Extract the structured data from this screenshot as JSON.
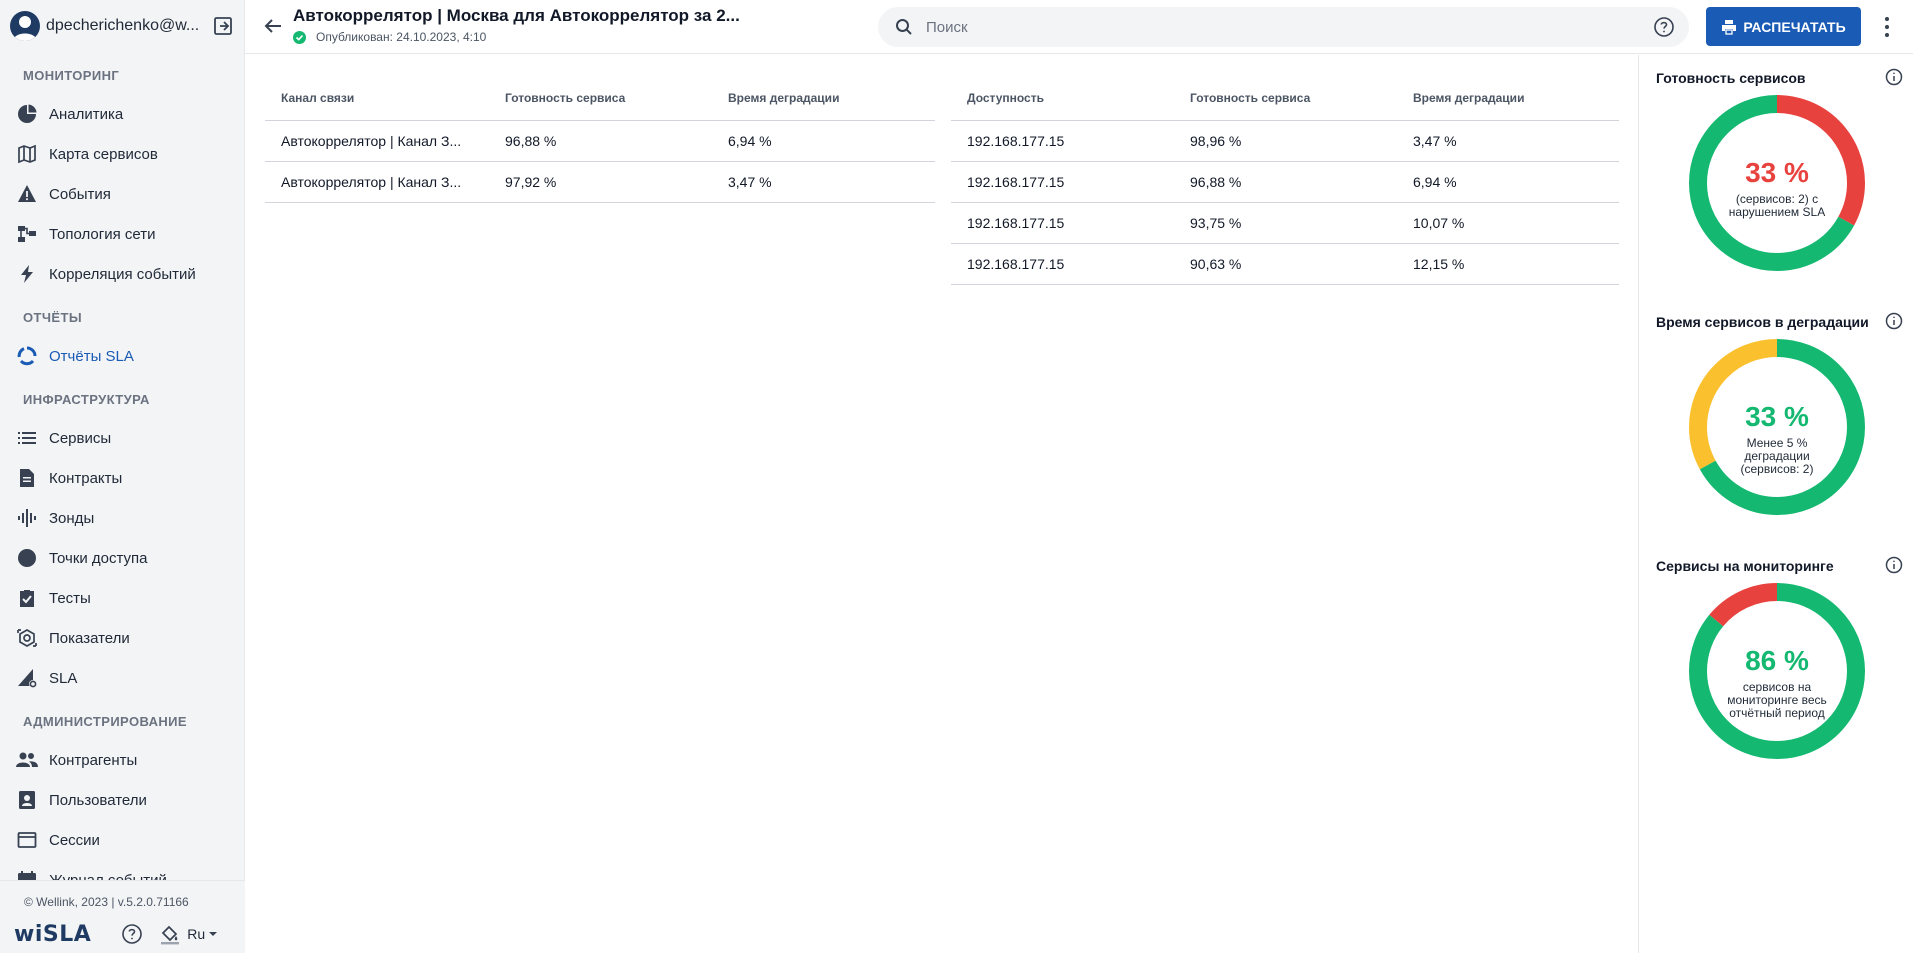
{
  "user": {
    "name": "dpecherichenko@w..."
  },
  "sidebar": {
    "sections": [
      {
        "title": "МОНИТОРИНГ",
        "items": [
          {
            "label": "Аналитика",
            "icon": "pie-chart-icon"
          },
          {
            "label": "Карта сервисов",
            "icon": "map-icon"
          },
          {
            "label": "События",
            "icon": "warning-icon"
          },
          {
            "label": "Топология сети",
            "icon": "topology-icon"
          },
          {
            "label": "Корреляция событий",
            "icon": "bolt-icon"
          }
        ]
      },
      {
        "title": "ОТЧЁТЫ",
        "items": [
          {
            "label": "Отчёты SLA",
            "icon": "circle-report-icon",
            "active": true
          }
        ]
      },
      {
        "title": "ИНФРАСТРУКТУРА",
        "items": [
          {
            "label": "Сервисы",
            "icon": "list-icon"
          },
          {
            "label": "Контракты",
            "icon": "document-icon"
          },
          {
            "label": "Зонды",
            "icon": "probe-icon"
          },
          {
            "label": "Точки доступа",
            "icon": "dot-icon"
          },
          {
            "label": "Тесты",
            "icon": "clipboard-check-icon"
          },
          {
            "label": "Показатели",
            "icon": "metrics-icon"
          },
          {
            "label": "SLA",
            "icon": "sla-icon"
          }
        ]
      },
      {
        "title": "АДМИНИСТРИРОВАНИЕ",
        "items": [
          {
            "label": "Контрагенты",
            "icon": "people-icon"
          },
          {
            "label": "Пользователи",
            "icon": "user-card-icon"
          },
          {
            "label": "Сессии",
            "icon": "window-icon"
          },
          {
            "label": "Журнал событий",
            "icon": "calendar-icon"
          }
        ]
      }
    ],
    "copyright": "© Wellink, 2023 | v.5.2.0.71166",
    "logo": "wiSLA",
    "language": "Ru"
  },
  "header": {
    "title": "Автокоррелятор | Москва для Автокоррелятор за 2...",
    "published": "Опубликован: 24.10.2023, 4:10",
    "search_placeholder": "Поиск",
    "print_label": "РАСПЕЧАТАТЬ"
  },
  "table1": {
    "headers": [
      "Канал связи",
      "Готовность сервиса",
      "Время деградации"
    ],
    "rows": [
      [
        "Автокоррелятор | Канал З...",
        "96,88 %",
        "6,94 %"
      ],
      [
        "Автокоррелятор | Канал З...",
        "97,92 %",
        "3,47 %"
      ]
    ]
  },
  "table2": {
    "headers": [
      "Доступность",
      "Готовность сервиса",
      "Время деградации"
    ],
    "rows": [
      [
        "192.168.177.15",
        "98,96 %",
        "3,47 %"
      ],
      [
        "192.168.177.15",
        "96,88 %",
        "6,94 %"
      ],
      [
        "192.168.177.15",
        "93,75 %",
        "10,07 %"
      ],
      [
        "192.168.177.15",
        "90,63 %",
        "12,15 %"
      ]
    ]
  },
  "widgets": [
    {
      "title": "Готовность сервисов",
      "percent": "33 %",
      "percent_color": "#e8423f",
      "description": "(сервисов: 2) с нарушением SLA",
      "segments": [
        {
          "fraction": 0.33,
          "color": "#e8423f"
        },
        {
          "fraction": 0.67,
          "color": "#14b870"
        }
      ]
    },
    {
      "title": "Время сервисов в деградации",
      "percent": "33 %",
      "percent_color": "#14b870",
      "description": "Менее 5 % деградации (сервисов: 2)",
      "segments": [
        {
          "fraction": 0.67,
          "color": "#14b870"
        },
        {
          "fraction": 0.33,
          "color": "#fbc02d"
        }
      ]
    },
    {
      "title": "Сервисы на мониторинге",
      "percent": "86 %",
      "percent_color": "#14b870",
      "description": "сервисов на мониторинге весь отчётный период",
      "segments": [
        {
          "fraction": 0.86,
          "color": "#14b870"
        },
        {
          "fraction": 0.14,
          "color": "#e8423f"
        }
      ]
    }
  ]
}
